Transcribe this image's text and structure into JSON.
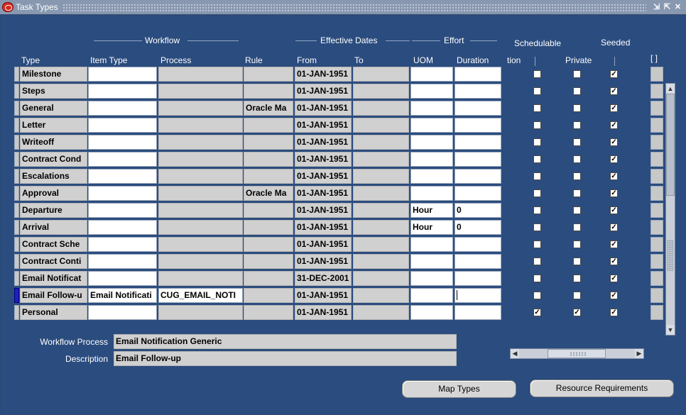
{
  "window": {
    "title": "Task Types"
  },
  "headers": {
    "workflow": "Workflow",
    "effective_dates": "Effective Dates",
    "effort": "Effort",
    "schedulable": "Schedulable",
    "seeded_group": "Seeded",
    "type": "Type",
    "item_type": "Item Type",
    "process": "Process",
    "rule": "Rule",
    "from": "From",
    "to": "To",
    "uom": "UOM",
    "duration": "Duration",
    "notification": "tion",
    "private": "Private",
    "more": "[ ]"
  },
  "rows": [
    {
      "type": "Milestone",
      "item_type": "",
      "process": "",
      "rule": "",
      "from": "01-JAN-1951",
      "to": "",
      "uom": "",
      "duration": "",
      "notification": false,
      "private": false,
      "seeded": true
    },
    {
      "type": "Steps",
      "item_type": "",
      "process": "",
      "rule": "",
      "from": "01-JAN-1951",
      "to": "",
      "uom": "",
      "duration": "",
      "notification": false,
      "private": false,
      "seeded": true
    },
    {
      "type": "General",
      "item_type": "",
      "process": "",
      "rule": "Oracle Ma",
      "from": "01-JAN-1951",
      "to": "",
      "uom": "",
      "duration": "",
      "notification": false,
      "private": false,
      "seeded": true
    },
    {
      "type": "Letter",
      "item_type": "",
      "process": "",
      "rule": "",
      "from": "01-JAN-1951",
      "to": "",
      "uom": "",
      "duration": "",
      "notification": false,
      "private": false,
      "seeded": true
    },
    {
      "type": "Writeoff",
      "item_type": "",
      "process": "",
      "rule": "",
      "from": "01-JAN-1951",
      "to": "",
      "uom": "",
      "duration": "",
      "notification": false,
      "private": false,
      "seeded": true
    },
    {
      "type": "Contract Cond",
      "item_type": "",
      "process": "",
      "rule": "",
      "from": "01-JAN-1951",
      "to": "",
      "uom": "",
      "duration": "",
      "notification": false,
      "private": false,
      "seeded": true
    },
    {
      "type": "Escalations",
      "item_type": "",
      "process": "",
      "rule": "",
      "from": "01-JAN-1951",
      "to": "",
      "uom": "",
      "duration": "",
      "notification": false,
      "private": false,
      "seeded": true
    },
    {
      "type": "Approval",
      "item_type": "",
      "process": "",
      "rule": "Oracle Ma",
      "from": "01-JAN-1951",
      "to": "",
      "uom": "",
      "duration": "",
      "notification": false,
      "private": false,
      "seeded": true
    },
    {
      "type": "Departure",
      "item_type": "",
      "process": "",
      "rule": "",
      "from": "01-JAN-1951",
      "to": "",
      "uom": "Hour",
      "duration": "0",
      "notification": false,
      "private": false,
      "seeded": true
    },
    {
      "type": "Arrival",
      "item_type": "",
      "process": "",
      "rule": "",
      "from": "01-JAN-1951",
      "to": "",
      "uom": "Hour",
      "duration": "0",
      "notification": false,
      "private": false,
      "seeded": true
    },
    {
      "type": "Contract Sche",
      "item_type": "",
      "process": "",
      "rule": "",
      "from": "01-JAN-1951",
      "to": "",
      "uom": "",
      "duration": "",
      "notification": false,
      "private": false,
      "seeded": true
    },
    {
      "type": "Contract Conti",
      "item_type": "",
      "process": "",
      "rule": "",
      "from": "01-JAN-1951",
      "to": "",
      "uom": "",
      "duration": "",
      "notification": false,
      "private": false,
      "seeded": true
    },
    {
      "type": "Email Notificat",
      "item_type": "",
      "process": "",
      "rule": "",
      "from": "31-DEC-2001",
      "to": "",
      "uom": "",
      "duration": "",
      "notification": false,
      "private": false,
      "seeded": true
    },
    {
      "type": "Email Follow-u",
      "item_type": "Email Notificati",
      "process": "CUG_EMAIL_NOTI",
      "rule": "",
      "from": "01-JAN-1951",
      "to": "",
      "uom": "",
      "duration": "",
      "notification": false,
      "private": false,
      "seeded": true,
      "current": true
    },
    {
      "type": "Personal",
      "item_type": "",
      "process": "",
      "rule": "",
      "from": "01-JAN-1951",
      "to": "",
      "uom": "",
      "duration": "",
      "notification": true,
      "private": true,
      "seeded": true
    }
  ],
  "footer": {
    "workflow_process_label": "Workflow Process",
    "workflow_process_value": "Email Notification Generic",
    "description_label": "Description",
    "description_value": "Email Follow-up"
  },
  "buttons": {
    "map_types": "Map Types",
    "resource_requirements": "Resource Requirements"
  },
  "colors": {
    "canvas": "#2b4c7e",
    "field_readonly": "#d0d0d0",
    "field_editable": "#ffffff",
    "title_bar": "#8898b0"
  }
}
